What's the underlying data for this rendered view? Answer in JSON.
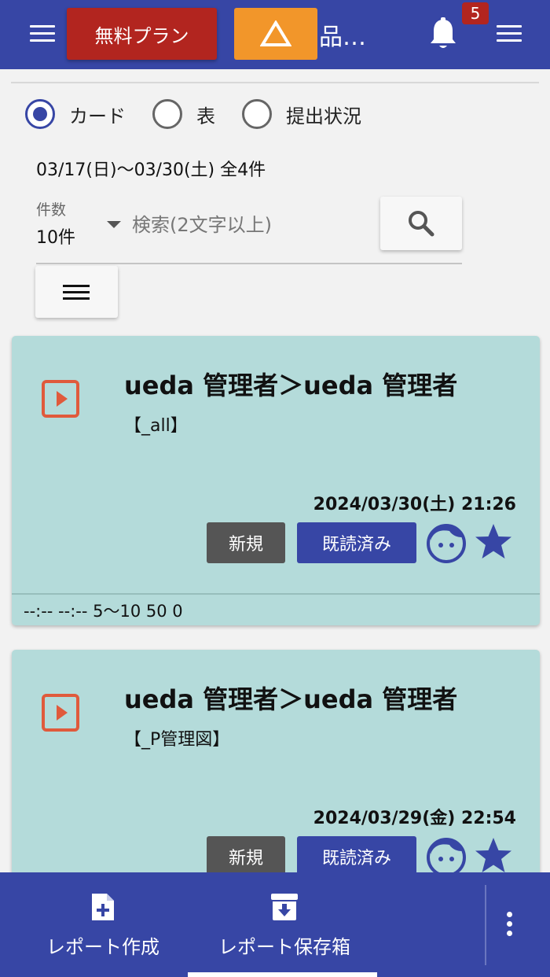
{
  "header": {
    "free_plan_label": "無料プラン",
    "title": "品…",
    "notification_count": "5"
  },
  "view_options": [
    {
      "label": "カード",
      "checked": true
    },
    {
      "label": "表",
      "checked": false
    },
    {
      "label": "提出状況",
      "checked": false
    }
  ],
  "period": "03/17(日)〜03/30(土) 全4件",
  "filter": {
    "count_label": "件数",
    "count_value": "10件",
    "search_placeholder": "検索(2文字以上)"
  },
  "cards": [
    {
      "title": "ueda 管理者＞ueda 管理者",
      "tag": "【_all】",
      "date": "2024/03/30(土) 21:26",
      "status_new": "新規",
      "status_read": "既読済み",
      "footer": "--:-- --:-- 5〜10 50 0"
    },
    {
      "title": "ueda 管理者＞ueda 管理者",
      "tag": "【_P管理図】",
      "date": "2024/03/29(金) 22:54",
      "status_new": "新規",
      "status_read": "既読済み"
    }
  ],
  "bottom_nav": {
    "create_label": "レポート作成",
    "archive_label": "レポート保存箱"
  },
  "colors": {
    "primary": "#3746a5",
    "danger": "#b2251f",
    "warning": "#f2962a",
    "card_bg": "#b4dbda"
  }
}
